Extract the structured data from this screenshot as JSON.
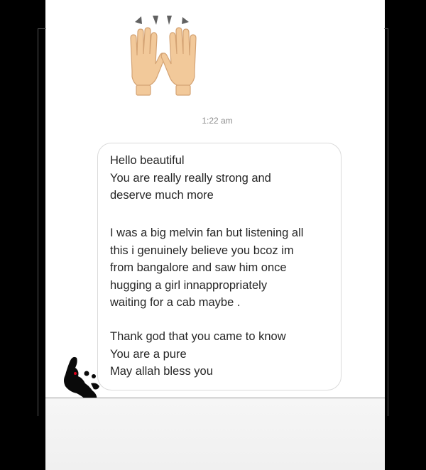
{
  "conversation": {
    "reaction_emoji": "raising-hands-emoji",
    "timestamp": "1:22 am",
    "message": {
      "paragraph1": [
        "Hello beautiful",
        "You are really really strong and",
        "deserve much more"
      ],
      "paragraph2": [
        "I was a big melvin fan but listening all",
        "this i genuinely believe you bcoz im",
        "from bangalore and saw him once",
        "hugging a girl innappropriately",
        "waiting for a cab maybe ."
      ],
      "paragraph3": [
        "Thank god that you came to know",
        "You are a pure",
        "May allah bless you"
      ]
    }
  },
  "colors": {
    "page_background": "#000000",
    "panel_background": "#ffffff",
    "bubble_border": "#dbdbdb",
    "text": "#262626",
    "timestamp": "#8e8e8e",
    "skin_tone": "#f2c99a"
  }
}
